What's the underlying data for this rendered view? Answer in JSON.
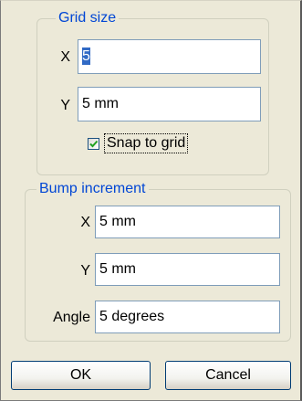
{
  "grid_size": {
    "title": "Grid size",
    "x_label": "X",
    "x_value": "5",
    "y_label": "Y",
    "y_value": "5 mm",
    "snap_label": "Snap to grid",
    "snap_checked": true
  },
  "bump_increment": {
    "title": "Bump increment",
    "x_label": "X",
    "x_value": "5 mm",
    "y_label": "Y",
    "y_value": "5 mm",
    "angle_label": "Angle",
    "angle_value": "5 degrees"
  },
  "buttons": {
    "ok_label": "OK",
    "cancel_label": "Cancel"
  },
  "colors": {
    "dialog_background": "#ece9d8",
    "group_title": "#0046d5",
    "input_border": "#7f9db9",
    "selection": "#316ac5",
    "checkmark": "#21a121"
  }
}
